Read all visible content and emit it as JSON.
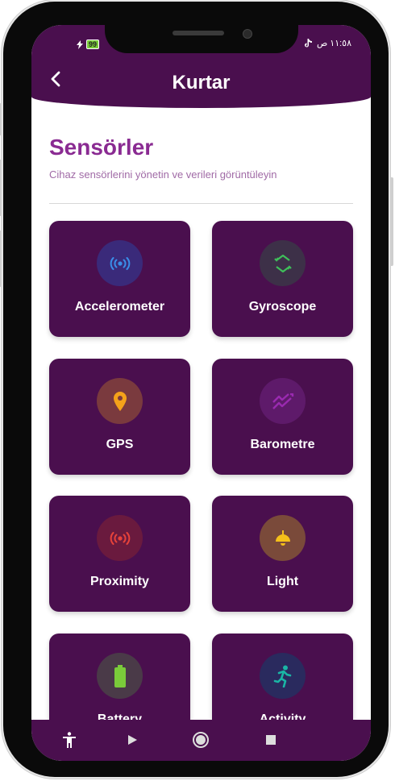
{
  "status_bar": {
    "battery": "99",
    "time": "١١:٥٨ ص"
  },
  "header": {
    "title": "Kurtar"
  },
  "page": {
    "title": "Sensörler",
    "subtitle": "Cihaz sensörlerini yönetin ve verileri görüntüleyin"
  },
  "sensors": [
    {
      "label": "Accelerometer",
      "icon": "sensors-icon",
      "icon_color": "#3a8ee8",
      "circle_bg": "#3a2a7a"
    },
    {
      "label": "Gyroscope",
      "icon": "rotate-icon",
      "icon_color": "#3fbf5a",
      "circle_bg": "#3d3048"
    },
    {
      "label": "GPS",
      "icon": "location-pin-icon",
      "icon_color": "#f5a21a",
      "circle_bg": "#7a3a3e"
    },
    {
      "label": "Barometre",
      "icon": "trending-icon",
      "icon_color": "#9a2ab0",
      "circle_bg": "#5e1a6a"
    },
    {
      "label": "Proximity",
      "icon": "sensors-icon",
      "icon_color": "#e8433a",
      "circle_bg": "#6a1a3e"
    },
    {
      "label": "Light",
      "icon": "lamp-icon",
      "icon_color": "#f5c01a",
      "circle_bg": "#7a4a3a"
    },
    {
      "label": "Battery",
      "icon": "battery-icon",
      "icon_color": "#7acb3a",
      "circle_bg": "#4a3a48"
    },
    {
      "label": "Activity",
      "icon": "running-icon",
      "icon_color": "#1ab5a5",
      "circle_bg": "#2a2a5e"
    }
  ],
  "nav": [
    "accessibility-icon",
    "play-icon",
    "home-circle-icon",
    "stop-icon"
  ]
}
